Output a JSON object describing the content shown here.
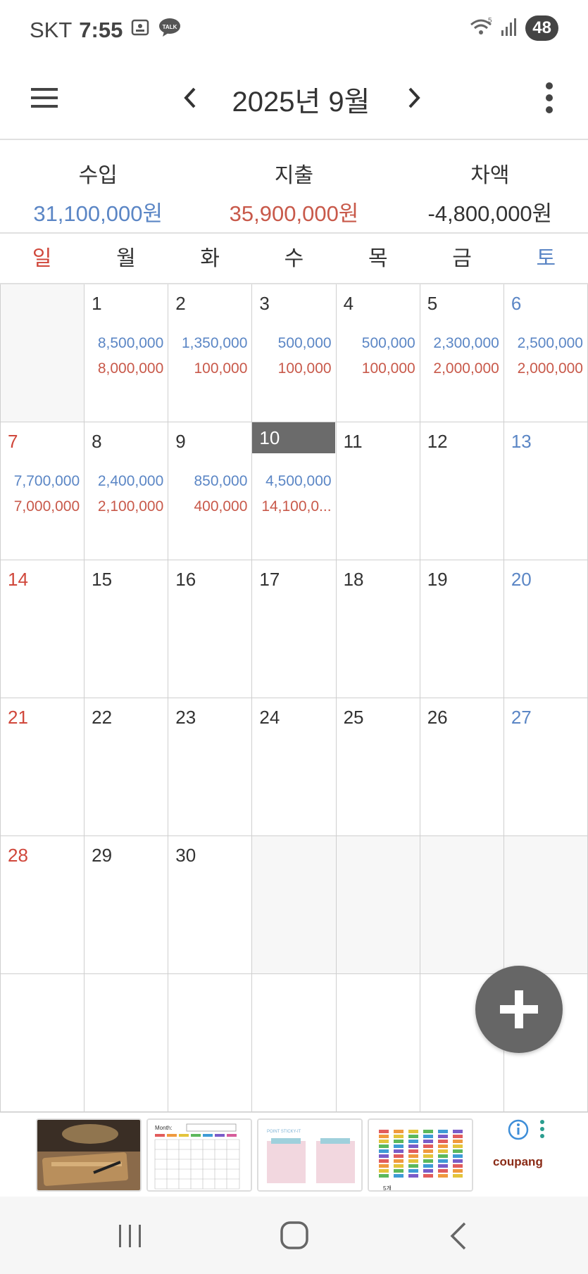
{
  "status_bar": {
    "carrier": "SKT",
    "time": "7:55",
    "talk_badge": "TALK",
    "wifi_badge": "5",
    "battery": "48"
  },
  "header": {
    "title": "2025년 9월"
  },
  "summary": {
    "income_label": "수입",
    "income_value": "31,100,000원",
    "expense_label": "지출",
    "expense_value": "35,900,000원",
    "diff_label": "차액",
    "diff_value": "-4,800,000원"
  },
  "weekdays": [
    "일",
    "월",
    "화",
    "수",
    "목",
    "금",
    "토"
  ],
  "calendar": {
    "today": "10",
    "weeks": [
      [
        {
          "day": "",
          "income": "",
          "expense": ""
        },
        {
          "day": "1",
          "income": "8,500,000",
          "expense": "8,000,000"
        },
        {
          "day": "2",
          "income": "1,350,000",
          "expense": "100,000"
        },
        {
          "day": "3",
          "income": "500,000",
          "expense": "100,000"
        },
        {
          "day": "4",
          "income": "500,000",
          "expense": "100,000"
        },
        {
          "day": "5",
          "income": "2,300,000",
          "expense": "2,000,000"
        },
        {
          "day": "6",
          "income": "2,500,000",
          "expense": "2,000,000"
        }
      ],
      [
        {
          "day": "7",
          "income": "7,700,000",
          "expense": "7,000,000"
        },
        {
          "day": "8",
          "income": "2,400,000",
          "expense": "2,100,000"
        },
        {
          "day": "9",
          "income": "850,000",
          "expense": "400,000"
        },
        {
          "day": "10",
          "income": "4,500,000",
          "expense": "14,100,0..."
        },
        {
          "day": "11",
          "income": "",
          "expense": ""
        },
        {
          "day": "12",
          "income": "",
          "expense": ""
        },
        {
          "day": "13",
          "income": "",
          "expense": ""
        }
      ],
      [
        {
          "day": "14",
          "income": "",
          "expense": ""
        },
        {
          "day": "15",
          "income": "",
          "expense": ""
        },
        {
          "day": "16",
          "income": "",
          "expense": ""
        },
        {
          "day": "17",
          "income": "",
          "expense": ""
        },
        {
          "day": "18",
          "income": "",
          "expense": ""
        },
        {
          "day": "19",
          "income": "",
          "expense": ""
        },
        {
          "day": "20",
          "income": "",
          "expense": ""
        }
      ],
      [
        {
          "day": "21",
          "income": "",
          "expense": ""
        },
        {
          "day": "22",
          "income": "",
          "expense": ""
        },
        {
          "day": "23",
          "income": "",
          "expense": ""
        },
        {
          "day": "24",
          "income": "",
          "expense": ""
        },
        {
          "day": "25",
          "income": "",
          "expense": ""
        },
        {
          "day": "26",
          "income": "",
          "expense": ""
        },
        {
          "day": "27",
          "income": "",
          "expense": ""
        }
      ],
      [
        {
          "day": "28",
          "income": "",
          "expense": ""
        },
        {
          "day": "29",
          "income": "",
          "expense": ""
        },
        {
          "day": "30",
          "income": "",
          "expense": ""
        },
        {
          "day": "",
          "income": "",
          "expense": ""
        },
        {
          "day": "",
          "income": "",
          "expense": ""
        },
        {
          "day": "",
          "income": "",
          "expense": ""
        },
        {
          "day": "",
          "income": "",
          "expense": ""
        }
      ],
      [
        {
          "day": "",
          "income": "",
          "expense": ""
        },
        {
          "day": "",
          "income": "",
          "expense": ""
        },
        {
          "day": "",
          "income": "",
          "expense": ""
        },
        {
          "day": "",
          "income": "",
          "expense": ""
        },
        {
          "day": "",
          "income": "",
          "expense": ""
        },
        {
          "day": "",
          "income": "",
          "expense": ""
        },
        {
          "day": "",
          "income": "",
          "expense": ""
        }
      ]
    ]
  },
  "ad": {
    "brand": "coupang",
    "thumb_month_label": "Month:",
    "thumb_sticky_label": "POINT STICKY-IT",
    "thumb_count_label": "5개"
  },
  "colors": {
    "income": "#5b86c5",
    "expense": "#c8594a",
    "sunday": "#d0473b",
    "saturday": "#5b86c5",
    "today_bg": "#6b6b6b",
    "fab": "#666666"
  },
  "icons": {
    "menu": "hamburger-icon",
    "prev": "chevron-left-icon",
    "next": "chevron-right-icon",
    "more": "more-vertical-icon",
    "fab": "plus-icon",
    "nav_recent": "recent-apps-icon",
    "nav_home": "home-icon",
    "nav_back": "back-icon"
  }
}
